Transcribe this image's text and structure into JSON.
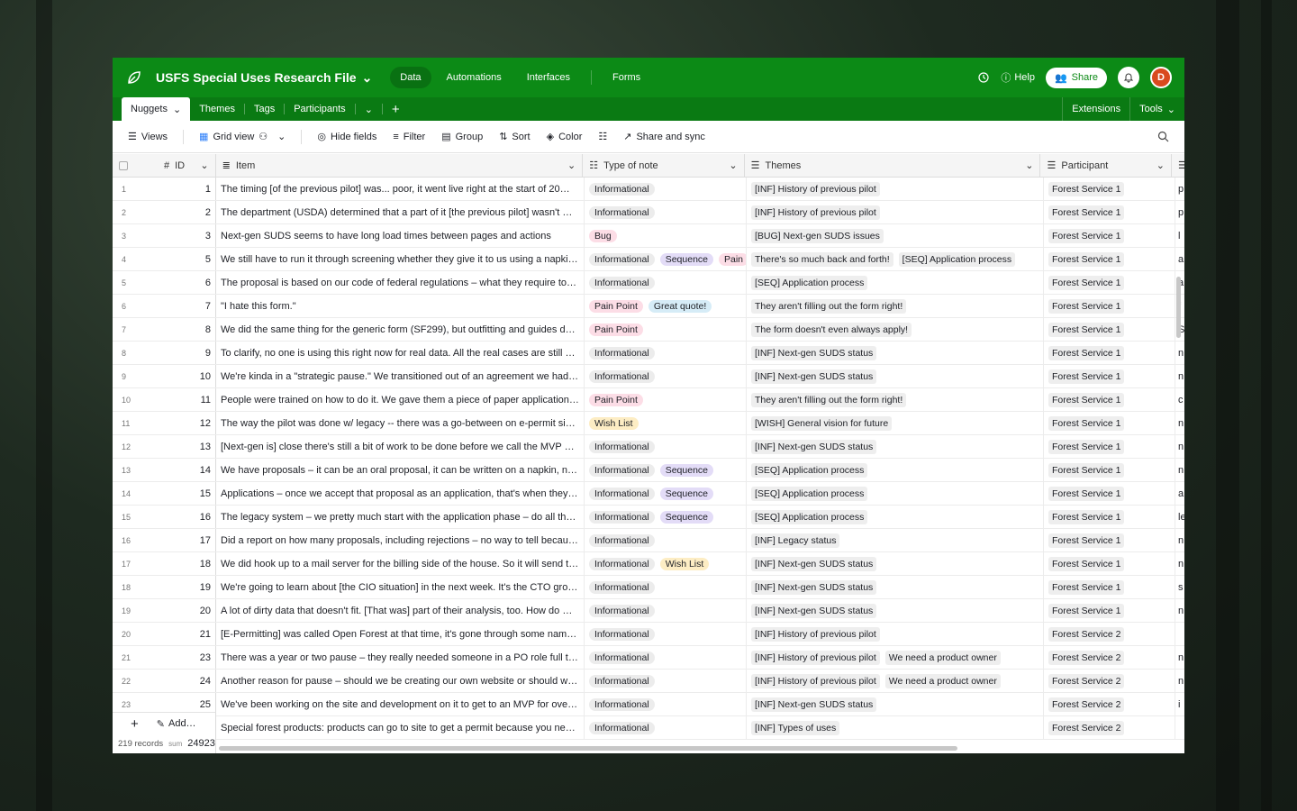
{
  "app": {
    "base_name": "USFS Special Uses Research File",
    "nav": [
      {
        "label": "Data",
        "active": true
      },
      {
        "label": "Automations",
        "active": false
      },
      {
        "label": "Interfaces",
        "active": false
      },
      {
        "label": "Forms",
        "active": false
      }
    ],
    "help_label": "Help",
    "share_label": "Share",
    "avatar_initial": "D",
    "accent_color": "#0c8a16"
  },
  "tables": {
    "active": "Nuggets",
    "others": [
      "Themes",
      "Tags",
      "Participants"
    ],
    "extensions_label": "Extensions",
    "tools_label": "Tools"
  },
  "toolbar": {
    "views_label": "Views",
    "grid_view_label": "Grid view",
    "hide_fields_label": "Hide fields",
    "filter_label": "Filter",
    "group_label": "Group",
    "sort_label": "Sort",
    "color_label": "Color",
    "share_sync_label": "Share and sync"
  },
  "columns": {
    "id": "ID",
    "item": "Item",
    "type": "Type of note",
    "themes": "Themes",
    "participant": "Participant"
  },
  "tag_colors": {
    "Informational": "#ececec",
    "Sequence": "#e3dcf7",
    "Pain Point": "#fcdde6",
    "Pain": "#fcdde6",
    "Great quote!": "#d6ecf7",
    "Bug": "#fcdde6",
    "Wish List": "#fdedc4"
  },
  "rows": [
    {
      "n": "1",
      "id": "1",
      "item": "The timing [of the previous pilot] was... poor, it went live right at the start of 20…",
      "types": [
        "Informational"
      ],
      "themes": [
        "[INF] History of previous pilot"
      ],
      "participant": "Forest Service 1",
      "more": "p"
    },
    {
      "n": "2",
      "id": "2",
      "item": "The department (USDA) determined that a part of it [the previous pilot] wasn't …",
      "types": [
        "Informational"
      ],
      "themes": [
        "[INF] History of previous pilot"
      ],
      "participant": "Forest Service 1",
      "more": "p"
    },
    {
      "n": "3",
      "id": "3",
      "item": "Next-gen SUDS seems to have long load times between pages and actions",
      "types": [
        "Bug"
      ],
      "themes": [
        "[BUG] Next-gen SUDS issues"
      ],
      "participant": "Forest Service 1",
      "more": "l"
    },
    {
      "n": "4",
      "id": "5",
      "item": "We still have to run it through screening whether they give it to us using a napki…",
      "types": [
        "Informational",
        "Sequence",
        "Pain"
      ],
      "themes": [
        "There's so much back and forth!",
        "[SEQ] Application process"
      ],
      "participant": "Forest Service 1",
      "more": "a"
    },
    {
      "n": "5",
      "id": "6",
      "item": "The proposal is based on our code of federal regulations – what they require to…",
      "types": [
        "Informational"
      ],
      "themes": [
        "[SEQ] Application process"
      ],
      "participant": "Forest Service 1",
      "more": "a"
    },
    {
      "n": "6",
      "id": "7",
      "item": "\"I hate this form.\"",
      "types": [
        "Pain Point",
        "Great quote!"
      ],
      "themes": [
        "They aren't filling out the form right!"
      ],
      "participant": "Forest Service 1",
      "more": "f"
    },
    {
      "n": "7",
      "id": "8",
      "item": "We did the same thing for the generic form (SF299), but outfitting and guides d…",
      "types": [
        "Pain Point"
      ],
      "themes": [
        "The form doesn't even always apply!"
      ],
      "participant": "Forest Service 1",
      "more": "S"
    },
    {
      "n": "8",
      "id": "9",
      "item": "To clarify, no one is using this right now for real data. All the real cases are still …",
      "types": [
        "Informational"
      ],
      "themes": [
        "[INF] Next-gen SUDS status"
      ],
      "participant": "Forest Service 1",
      "more": "n"
    },
    {
      "n": "9",
      "id": "10",
      "item": "We're kinda in a \"strategic pause.\" We transitioned out of an agreement we had…",
      "types": [
        "Informational"
      ],
      "themes": [
        "[INF] Next-gen SUDS status"
      ],
      "participant": "Forest Service 1",
      "more": "n"
    },
    {
      "n": "10",
      "id": "11",
      "item": "People were trained on how to do it. We gave them a piece of paper application…",
      "types": [
        "Pain Point"
      ],
      "themes": [
        "They aren't filling out the form right!"
      ],
      "participant": "Forest Service 1",
      "more": "c"
    },
    {
      "n": "11",
      "id": "12",
      "item": "The way the pilot was done w/ legacy -- there was a go-between on e-permit si…",
      "types": [
        "Wish List"
      ],
      "themes": [
        "[WISH] General vision for future"
      ],
      "participant": "Forest Service 1",
      "more": "n"
    },
    {
      "n": "12",
      "id": "13",
      "item": "[Next-gen is] close there's still a bit of work to be done before we call the MVP …",
      "types": [
        "Informational"
      ],
      "themes": [
        "[INF] Next-gen SUDS status"
      ],
      "participant": "Forest Service 1",
      "more": "n"
    },
    {
      "n": "13",
      "id": "14",
      "item": "We have proposals – it can be an oral proposal, it can be written on a napkin, n…",
      "types": [
        "Informational",
        "Sequence"
      ],
      "themes": [
        "[SEQ] Application process"
      ],
      "participant": "Forest Service 1",
      "more": "n"
    },
    {
      "n": "14",
      "id": "15",
      "item": "Applications – once we accept that proposal as an application, that's when they…",
      "types": [
        "Informational",
        "Sequence"
      ],
      "themes": [
        "[SEQ] Application process"
      ],
      "participant": "Forest Service 1",
      "more": "a"
    },
    {
      "n": "15",
      "id": "16",
      "item": "The legacy system – we pretty much start with the application phase – do all th…",
      "types": [
        "Informational",
        "Sequence"
      ],
      "themes": [
        "[SEQ] Application process"
      ],
      "participant": "Forest Service 1",
      "more": "le"
    },
    {
      "n": "16",
      "id": "17",
      "item": "Did a report on how many proposals, including rejections – no way to tell becau…",
      "types": [
        "Informational"
      ],
      "themes": [
        "[INF] Legacy status"
      ],
      "participant": "Forest Service 1",
      "more": "n"
    },
    {
      "n": "17",
      "id": "18",
      "item": "We did hook up to a mail server for the billing side of the house. So it will send t…",
      "types": [
        "Informational",
        "Wish List"
      ],
      "themes": [
        "[INF] Next-gen SUDS status"
      ],
      "participant": "Forest Service 1",
      "more": "n"
    },
    {
      "n": "18",
      "id": "19",
      "item": "We're going to learn about [the CIO situation] in the next week. It's the CTO gro…",
      "types": [
        "Informational"
      ],
      "themes": [
        "[INF] Next-gen SUDS status"
      ],
      "participant": "Forest Service 1",
      "more": "s"
    },
    {
      "n": "19",
      "id": "20",
      "item": "A lot of dirty data that doesn't fit. [That was] part of their analysis, too. How do …",
      "types": [
        "Informational"
      ],
      "themes": [
        "[INF] Next-gen SUDS status"
      ],
      "participant": "Forest Service 1",
      "more": "n"
    },
    {
      "n": "20",
      "id": "21",
      "item": "[E-Permitting] was called Open Forest at that time, it's gone through some nam…",
      "types": [
        "Informational"
      ],
      "themes": [
        "[INF] History of previous pilot"
      ],
      "participant": "Forest Service 2",
      "more": ""
    },
    {
      "n": "21",
      "id": "23",
      "item": "There was a year or two pause – they really needed someone in a PO role full ti…",
      "types": [
        "Informational"
      ],
      "themes": [
        "[INF] History of previous pilot",
        "We need a product owner"
      ],
      "participant": "Forest Service 2",
      "more": "n"
    },
    {
      "n": "22",
      "id": "24",
      "item": "Another reason for pause – should we be creating our own website or should w…",
      "types": [
        "Informational"
      ],
      "themes": [
        "[INF] History of previous pilot",
        "We need a product owner"
      ],
      "participant": "Forest Service 2",
      "more": "n"
    },
    {
      "n": "23",
      "id": "25",
      "item": "We've been working on the site and development on it to get to an MVP for ove…",
      "types": [
        "Informational"
      ],
      "themes": [
        "[INF] Next-gen SUDS status"
      ],
      "participant": "Forest Service 2",
      "more": "i"
    },
    {
      "n": "",
      "id": "",
      "item": "Special forest products: products can go to site to get a permit because you ne…",
      "types": [
        "Informational"
      ],
      "themes": [
        "[INF] Types of uses"
      ],
      "participant": "Forest Service 2",
      "more": ""
    }
  ],
  "footer": {
    "add_label": "Add…",
    "records_label": "219 records",
    "sum_prefix": "sum",
    "sum_value": "24923"
  }
}
